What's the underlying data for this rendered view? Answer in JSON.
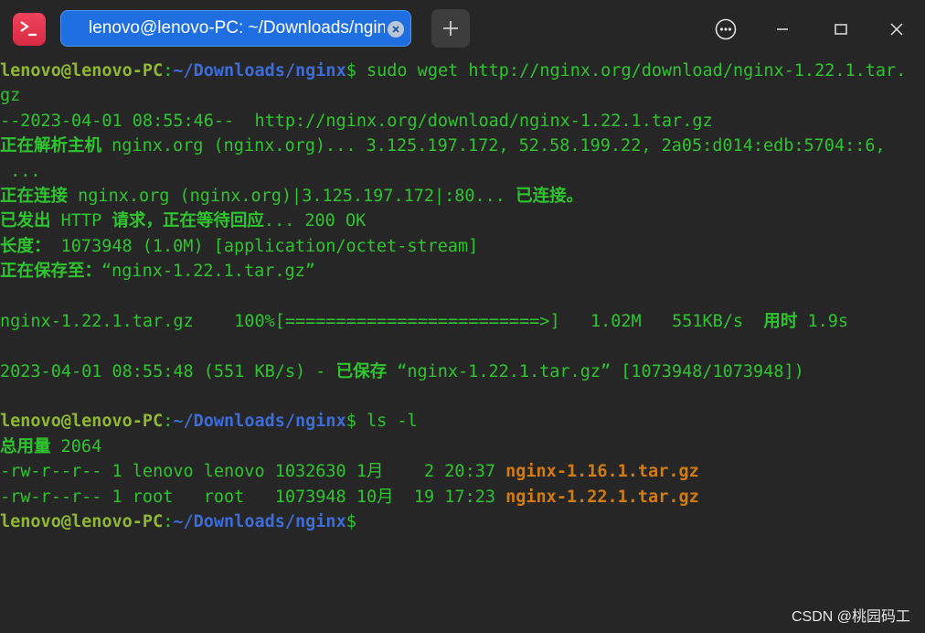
{
  "titlebar": {
    "tab_title": "lenovo@lenovo-PC: ~/Downloads/nginx",
    "app_icon": "terminal-app-icon",
    "tab_close_icon": "close-icon",
    "new_tab_icon": "plus-icon",
    "menu_icon": "more-options-icon",
    "minimize_icon": "minimize-icon",
    "maximize_icon": "maximize-icon",
    "close_icon": "close-icon"
  },
  "terminal": {
    "prompt_user": "lenovo@lenovo-PC",
    "prompt_colon": ":",
    "prompt_path": "~/Downloads/nginx",
    "prompt_dollar": "$",
    "cmd1": " sudo wget http://nginx.org/download/nginx-1.22.1.tar.",
    "cmd1_wrap": "gz",
    "l_time": "--2023-04-01 08:55:46--  http://nginx.org/download/nginx-1.22.1.tar.gz",
    "l_resolve_label": "正在解析主机",
    "l_resolve_text": " nginx.org (nginx.org)... 3.125.197.172, 52.58.199.22, 2a05:d014:edb:5704::6,",
    "l_resolve_wrap": " ...",
    "l_connect_label": "正在连接",
    "l_connect_text": " nginx.org (nginx.org)|3.125.197.172|:80... ",
    "l_connect_done": "已连接。",
    "l_sent_label1": "已发出",
    "l_sent_http": " HTTP ",
    "l_sent_label2": "请求，正在等待回应",
    "l_sent_text": "... 200 OK",
    "l_len_label": "长度：",
    "l_len_text": " 1073948 (1.0M) [application/octet-stream]",
    "l_save_label": "正在保存至：",
    "l_save_text": "“nginx-1.22.1.tar.gz”",
    "l_progress": "nginx-1.22.1.tar.gz    100%[=========================>]   1.02M   551KB/s  ",
    "l_progress_label": "用时",
    "l_progress_time": " 1.9s",
    "l_done_text": "2023-04-01 08:55:48 (551 KB/s) - ",
    "l_done_label": "已保存",
    "l_done_file": " “nginx-1.22.1.tar.gz” [1073948/1073948])",
    "cmd2": " ls -l",
    "l_total_label": "总用量",
    "l_total_value": " 2064",
    "files": [
      {
        "meta": "-rw-r--r-- 1 lenovo lenovo 1032630 1月    2 20:37 ",
        "name": "nginx-1.16.1.tar.gz"
      },
      {
        "meta": "-rw-r--r-- 1 root   root   1073948 10月  19 17:23 ",
        "name": "nginx-1.22.1.tar.gz"
      }
    ]
  },
  "watermark": "CSDN @桃园码工"
}
